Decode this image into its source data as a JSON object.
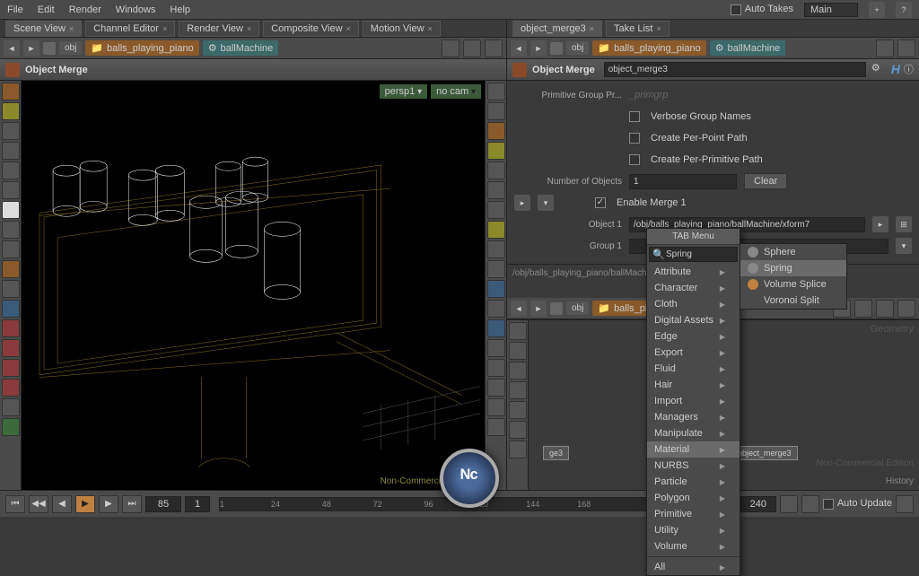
{
  "menubar": {
    "items": [
      "File",
      "Edit",
      "Render",
      "Windows",
      "Help"
    ],
    "auto_takes": "Auto Takes",
    "main": "Main"
  },
  "left": {
    "tabs": [
      "Scene View",
      "Channel Editor",
      "Render View",
      "Composite View",
      "Motion View"
    ],
    "path": {
      "root": "obj",
      "scene": "balls_playing_piano",
      "node": "ballMachine"
    },
    "header": "Object Merge",
    "cam": {
      "view": "persp1",
      "cam": "no cam"
    },
    "watermark": "Non-Commercial Edition"
  },
  "right": {
    "tabs": [
      "object_merge3",
      "Take List"
    ],
    "path": {
      "root": "obj",
      "scene": "balls_playing_piano",
      "node": "ballMachine"
    },
    "header": "Object Merge",
    "header_node": "object_merge3",
    "params": {
      "prim_group_label": "Primitive Group Pr...",
      "prim_group_value": "_primgrp",
      "verbose": "Verbose Group Names",
      "per_point": "Create Per-Point Path",
      "per_prim": "Create Per-Primitive Path",
      "num_objects_label": "Number of Objects",
      "num_objects_value": "1",
      "clear": "Clear",
      "enable_merge": "Enable Merge 1",
      "object1_label": "Object 1",
      "object1_value": "/obj/balls_playing_piano/ballMachine/xform7",
      "group1_label": "Group 1"
    },
    "network": {
      "path": "/obj/balls_playing_piano/ballMachine",
      "crumb_root": "obj",
      "crumb_node": "balls_pl...",
      "watermark": "Non-Commercial Edition",
      "side_label": "Geometry",
      "node_a": "ge3",
      "node_b": "object_merge3",
      "history": "History"
    }
  },
  "tab_menu": {
    "title": "TAB Menu",
    "search": "Spring",
    "items": [
      "Attribute",
      "Character",
      "Cloth",
      "Digital Assets",
      "Edge",
      "Export",
      "Fluid",
      "Hair",
      "Import",
      "Managers",
      "Manipulate",
      "Material",
      "NURBS",
      "Particle",
      "Polygon",
      "Primitive",
      "Utility",
      "Volume"
    ],
    "all": "All",
    "submenu": [
      "Sphere",
      "Spring",
      "Volume Splice",
      "Voronoi Split"
    ]
  },
  "timeline": {
    "frame": "85",
    "start": "1",
    "end": "240",
    "ticks": [
      "1",
      "24",
      "48",
      "72",
      "96",
      "120",
      "144",
      "168"
    ],
    "auto_update": "Auto Update"
  }
}
